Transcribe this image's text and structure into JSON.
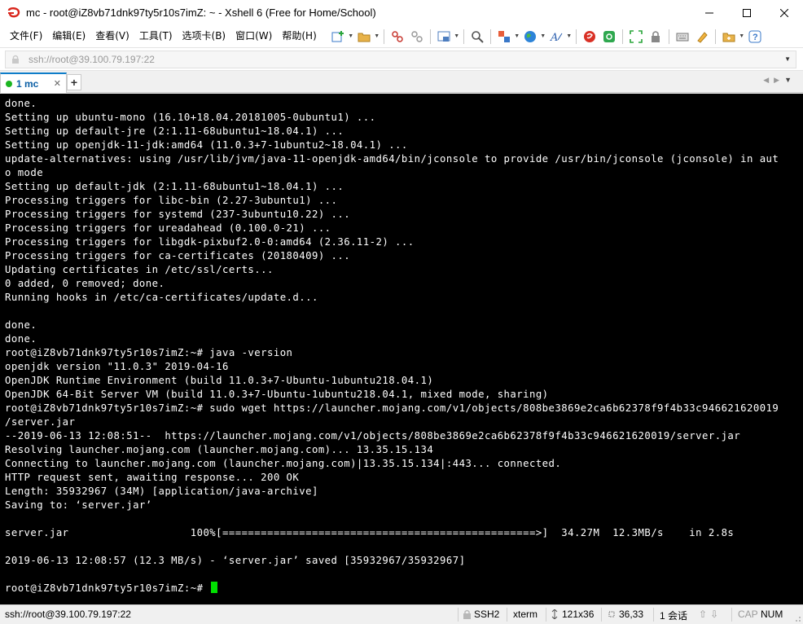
{
  "window": {
    "title": "mc - root@iZ8vb71dnk97ty5r10s7imZ: ~ - Xshell 6 (Free for Home/School)"
  },
  "menu": [
    {
      "label": "文件(F)"
    },
    {
      "label": "编辑(E)"
    },
    {
      "label": "查看(V)"
    },
    {
      "label": "工具(T)"
    },
    {
      "label": "选项卡(B)"
    },
    {
      "label": "窗口(W)"
    },
    {
      "label": "帮助(H)"
    }
  ],
  "address": {
    "value": "ssh://root@39.100.79.197:22"
  },
  "tabs": [
    {
      "label": "1 mc",
      "status_color": "#1bb520"
    }
  ],
  "terminal": {
    "lines": [
      "done.",
      "Setting up ubuntu-mono (16.10+18.04.20181005-0ubuntu1) ...",
      "Setting up default-jre (2:1.11-68ubuntu1~18.04.1) ...",
      "Setting up openjdk-11-jdk:amd64 (11.0.3+7-1ubuntu2~18.04.1) ...",
      "update-alternatives: using /usr/lib/jvm/java-11-openjdk-amd64/bin/jconsole to provide /usr/bin/jconsole (jconsole) in aut",
      "o mode",
      "Setting up default-jdk (2:1.11-68ubuntu1~18.04.1) ...",
      "Processing triggers for libc-bin (2.27-3ubuntu1) ...",
      "Processing triggers for systemd (237-3ubuntu10.22) ...",
      "Processing triggers for ureadahead (0.100.0-21) ...",
      "Processing triggers for libgdk-pixbuf2.0-0:amd64 (2.36.11-2) ...",
      "Processing triggers for ca-certificates (20180409) ...",
      "Updating certificates in /etc/ssl/certs...",
      "0 added, 0 removed; done.",
      "Running hooks in /etc/ca-certificates/update.d...",
      "",
      "done.",
      "done.",
      "root@iZ8vb71dnk97ty5r10s7imZ:~# java -version",
      "openjdk version \"11.0.3\" 2019-04-16",
      "OpenJDK Runtime Environment (build 11.0.3+7-Ubuntu-1ubuntu218.04.1)",
      "OpenJDK 64-Bit Server VM (build 11.0.3+7-Ubuntu-1ubuntu218.04.1, mixed mode, sharing)",
      "root@iZ8vb71dnk97ty5r10s7imZ:~# sudo wget https://launcher.mojang.com/v1/objects/808be3869e2ca6b62378f9f4b33c946621620019",
      "/server.jar",
      "--2019-06-13 12:08:51--  https://launcher.mojang.com/v1/objects/808be3869e2ca6b62378f9f4b33c946621620019/server.jar",
      "Resolving launcher.mojang.com (launcher.mojang.com)... 13.35.15.134",
      "Connecting to launcher.mojang.com (launcher.mojang.com)|13.35.15.134|:443... connected.",
      "HTTP request sent, awaiting response... 200 OK",
      "Length: 35932967 (34M) [application/java-archive]",
      "Saving to: ‘server.jar’",
      "",
      "server.jar                   100%[=================================================>]  34.27M  12.3MB/s    in 2.8s",
      "",
      "2019-06-13 12:08:57 (12.3 MB/s) - ‘server.jar’ saved [35932967/35932967]",
      "",
      "root@iZ8vb71dnk97ty5r10s7imZ:~# "
    ],
    "cursor_color": "#00e000"
  },
  "status": {
    "connection": "ssh://root@39.100.79.197:22",
    "protocol": "SSH2",
    "terminal_type": "xterm",
    "size": "121x36",
    "position": "36,33",
    "sessions": "1 会话",
    "caps": "CAP",
    "num": "NUM"
  }
}
